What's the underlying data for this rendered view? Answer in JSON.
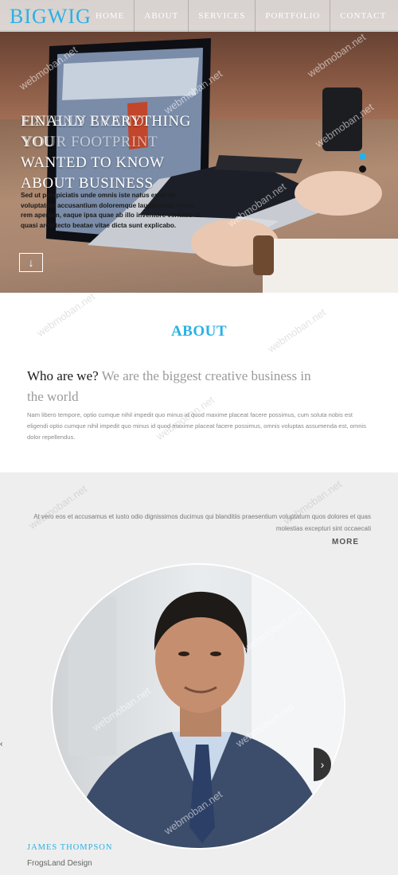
{
  "header": {
    "brand": "BIGWIG",
    "nav": [
      "HOME",
      "ABOUT",
      "SERVICES",
      "PORTFOLIO",
      "CONTACT"
    ]
  },
  "hero": {
    "headline_lines": [
      "FINALLY EVERYTHING YOU",
      "WANTED TO KNOW",
      "ABOUT BUSINESS"
    ],
    "ghost_lines": [
      "EXTEND BRAND",
      "YOUR FOOTPRINT",
      ""
    ],
    "text": "Sed ut perspiciatis unde omnis iste natus error sit voluptatem accusantium doloremque laudantium, totam rem aperiam, eaque ipsa quae ab illo inventore veritatis et quasi architecto beatae vitae dicta sunt explicabo.",
    "down_icon": "arrow-down-icon",
    "slider_dots": 2,
    "active_dot": 1
  },
  "about": {
    "title": "ABOUT",
    "question": "Who are we?",
    "answer": "We are the biggest creative business in the world",
    "body": "Nam libero tempore, optio cumque nihil impedit quo minus id quod maxime placeat facere possimus, cum soluta nobis est eligendi optio cumque nihil impedit quo minus id quod maxime placeat facere possimus, omnis voluptas assumenda est, omnis dolor repellendus."
  },
  "team": {
    "text": "At vero eos et accusamus et iusto odio dignissimos ducimus qui blanditiis praesentium voluptatum quos dolores et quas molestias excepturi sint occaecati",
    "more_label": "MORE",
    "member_name": "JAMES THOMPSON",
    "member_role": "FrogsLand Design",
    "next_icon": "chevron-right-icon"
  },
  "colors": {
    "accent": "#29b1e6",
    "section_gray": "#eeeeee"
  },
  "watermark": "webmoban.net"
}
